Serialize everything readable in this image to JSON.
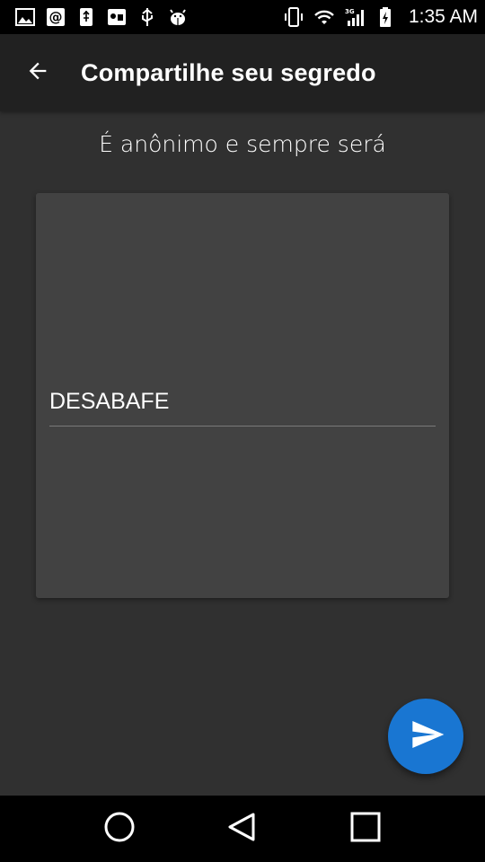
{
  "status_bar": {
    "time": "1:35 AM",
    "left_icons": [
      "image-icon",
      "at-sign-icon",
      "usb-icon",
      "vpn-icon",
      "usb-debug-icon",
      "android-debug-icon"
    ],
    "right_icons": [
      "vibrate-icon",
      "wifi-icon",
      "signal-3g-icon",
      "battery-charging-icon"
    ],
    "signal_label": "3G"
  },
  "app_bar": {
    "title": "Compartilhe seu segredo",
    "back_icon": "arrow-back-icon"
  },
  "main": {
    "subtitle": "É anônimo e sempre será",
    "secret_input": {
      "placeholder": "DESABAFE",
      "value": ""
    }
  },
  "fab": {
    "icon": "send-icon",
    "color": "#1976d2"
  },
  "nav_bar": {
    "icons": [
      "home-circle-icon",
      "back-triangle-icon",
      "recents-square-icon"
    ]
  },
  "colors": {
    "background": "#303030",
    "app_bar": "#212121",
    "card": "#424242",
    "accent": "#1976d2"
  }
}
